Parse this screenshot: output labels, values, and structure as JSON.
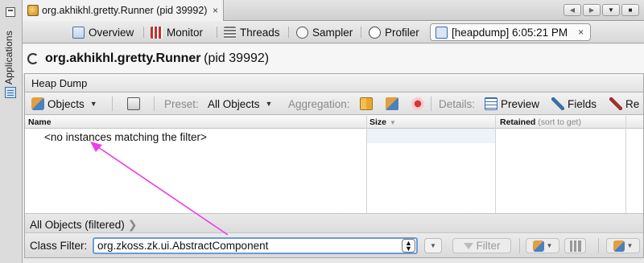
{
  "sidebar": {
    "label": "Applications"
  },
  "doc_tab": {
    "title": "org.akhikhl.gretty.Runner (pid 39992)",
    "close": "×"
  },
  "window_controls": [
    "◀",
    "▶",
    "▼",
    "■"
  ],
  "view_tabs": [
    {
      "label": "Overview",
      "icon": "overview-icon"
    },
    {
      "label": "Monitor",
      "icon": "monitor-icon"
    },
    {
      "label": "Threads",
      "icon": "threads-icon"
    },
    {
      "label": "Sampler",
      "icon": "sampler-icon"
    },
    {
      "label": "Profiler",
      "icon": "profiler-icon"
    },
    {
      "label": "[heapdump] 6:05:21 PM",
      "icon": "heapdump-icon",
      "close": "×",
      "active": true
    }
  ],
  "title": {
    "name": "org.akhikhl.gretty.Runner",
    "pid": "(pid 39992)"
  },
  "panel": {
    "header": "Heap Dump",
    "toolbar": {
      "objects_label": "Objects",
      "preset_label": "Preset:",
      "preset_value": "All Objects",
      "aggregation_label": "Aggregation:",
      "details_label": "Details:",
      "preview_label": "Preview",
      "fields_label": "Fields",
      "references_label": "Re"
    },
    "table": {
      "col_name": "Name",
      "col_size": "Size",
      "col_retained": "Retained",
      "retained_hint": "(sort to get)",
      "empty_message": "<no instances matching the filter>"
    },
    "breadcrumb": "All Objects (filtered)",
    "filter": {
      "label": "Class Filter:",
      "value": "org.zkoss.zk.ui.AbstractComponent",
      "button_label": "Filter"
    }
  },
  "colors": {
    "annotation_arrow": "#ee3de8",
    "focus_ring": "#6a9bd8"
  }
}
